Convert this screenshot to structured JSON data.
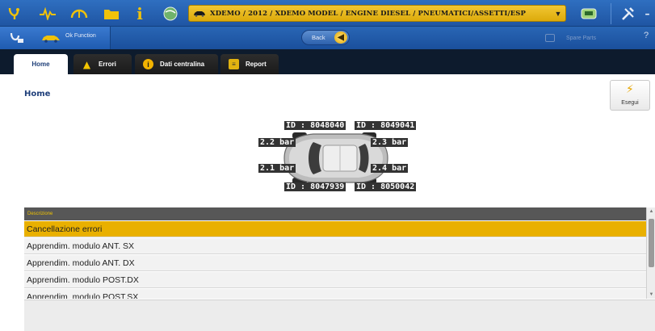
{
  "toolbar": {
    "icons": [
      "diagnosis-icon",
      "ecg-icon",
      "gauge-icon",
      "folder-icon",
      "info-icon",
      "globe-icon",
      "tools-icon",
      "settings-icon"
    ],
    "vehicle_path": "XDEMO / 2012 / XDEMO MODEL / ENGINE DIESEL / PNEUMATICI/ASSETTI/ESP"
  },
  "subbar": {
    "function_label": "Ok Function",
    "back_label": "Back",
    "spare_parts_label": "Spare Parts"
  },
  "tabs": [
    {
      "label": "Home",
      "icon": ""
    },
    {
      "label": "Errori",
      "icon": "warning-icon"
    },
    {
      "label": "Dati centralina",
      "icon": "info-icon"
    },
    {
      "label": "Report",
      "icon": "report-icon"
    }
  ],
  "main": {
    "page_title": "Home",
    "execute_label": "Esegui"
  },
  "tpms": {
    "front_left_id": "ID : 8048040",
    "front_right_id": "ID : 8049041",
    "rear_left_id": "ID : 8047939",
    "rear_right_id": "ID : 8050042",
    "front_left_pressure": "2.2 bar",
    "front_right_pressure": "2.3 bar",
    "rear_left_pressure": "2.1 bar",
    "rear_right_pressure": "2.4 bar"
  },
  "list": {
    "header": "Descrizione",
    "rows": [
      "Cancellazione errori",
      "Apprendim. modulo ANT. SX",
      "Apprendim. modulo ANT. DX",
      "Apprendim. modulo POST.DX",
      "Apprendim. modulo POST.SX"
    ],
    "selected_index": 0
  },
  "colors": {
    "accent": "#e9b000",
    "toolbar": "#2a64b3",
    "tab_band": "#0d1b2d",
    "title": "#1f3f7a"
  }
}
